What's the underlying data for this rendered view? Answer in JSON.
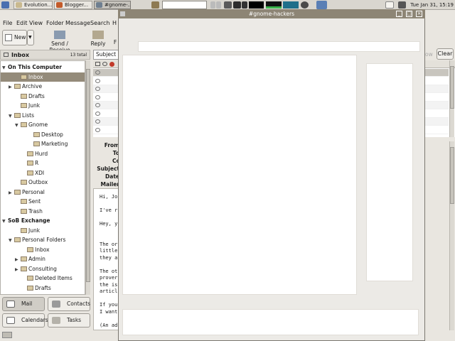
{
  "panel": {
    "tasks": [
      {
        "label": "Evolution..."
      },
      {
        "label": "Blogger..."
      },
      {
        "label": "#gnome-..."
      }
    ],
    "clock": "Tue Jan 31, 15:19"
  },
  "evolution": {
    "menu": [
      "File",
      "Edit",
      "View",
      "Folder",
      "Message",
      "Search",
      "H"
    ],
    "toolbar": {
      "new_label": "New",
      "send_receive_label": "Send / Receive",
      "reply_label": "Reply",
      "reply_partial": "F"
    },
    "sidebar_title": "Inbox",
    "sidebar_count": "13 total",
    "subject_partial": "Subject c",
    "search_partial": "ow",
    "clear_label": "Clear",
    "tree": [
      {
        "label": "On This Computer",
        "kind": "group",
        "indent": 0,
        "tri": "▼"
      },
      {
        "label": "Inbox",
        "kind": "sel",
        "indent": 2,
        "tri": ""
      },
      {
        "label": "Archive",
        "kind": "",
        "indent": 1,
        "tri": "▶"
      },
      {
        "label": "Drafts",
        "kind": "",
        "indent": 2,
        "tri": ""
      },
      {
        "label": "Junk",
        "kind": "",
        "indent": 2,
        "tri": ""
      },
      {
        "label": "Lists",
        "kind": "",
        "indent": 1,
        "tri": "▼"
      },
      {
        "label": "Gnome",
        "kind": "",
        "indent": 2,
        "tri": "▼"
      },
      {
        "label": "Desktop",
        "kind": "",
        "indent": 4,
        "tri": ""
      },
      {
        "label": "Marketing",
        "kind": "",
        "indent": 4,
        "tri": ""
      },
      {
        "label": "Hurd",
        "kind": "",
        "indent": 3,
        "tri": ""
      },
      {
        "label": "R",
        "kind": "",
        "indent": 3,
        "tri": ""
      },
      {
        "label": "XDI",
        "kind": "",
        "indent": 3,
        "tri": ""
      },
      {
        "label": "Outbox",
        "kind": "",
        "indent": 2,
        "tri": ""
      },
      {
        "label": "Personal",
        "kind": "",
        "indent": 1,
        "tri": "▶"
      },
      {
        "label": "Sent",
        "kind": "",
        "indent": 2,
        "tri": ""
      },
      {
        "label": "Trash",
        "kind": "",
        "indent": 2,
        "tri": ""
      },
      {
        "label": "SoB Exchange",
        "kind": "group",
        "indent": 0,
        "tri": "▼"
      },
      {
        "label": "Junk",
        "kind": "",
        "indent": 2,
        "tri": ""
      },
      {
        "label": "Personal Folders",
        "kind": "",
        "indent": 1,
        "tri": "▼"
      },
      {
        "label": "Inbox",
        "kind": "",
        "indent": 3,
        "tri": ""
      },
      {
        "label": "Admin",
        "kind": "",
        "indent": 2,
        "tri": "▶"
      },
      {
        "label": "Consulting",
        "kind": "",
        "indent": 2,
        "tri": "▶"
      },
      {
        "label": "Deleted Items",
        "kind": "",
        "indent": 3,
        "tri": ""
      },
      {
        "label": "Drafts",
        "kind": "",
        "indent": 3,
        "tri": ""
      }
    ],
    "switcher": {
      "mail": "Mail",
      "contacts": "Contacts",
      "calendars": "Calendars",
      "tasks": "Tasks"
    },
    "header_labels": [
      "From:",
      "To:",
      "Cc:",
      "Subject:",
      "Date:",
      "Mailer:"
    ],
    "body_lines": [
      "Hi, Jo",
      "",
      "I've r",
      "",
      "Hey, y",
      "",
      "",
      "The or",
      "little",
      "they a",
      "",
      "The ot",
      "prover",
      "the is",
      "articl",
      "",
      "If you",
      "I want",
      "",
      "(An ad"
    ]
  },
  "xchat": {
    "title": "#gnome-hackers"
  }
}
